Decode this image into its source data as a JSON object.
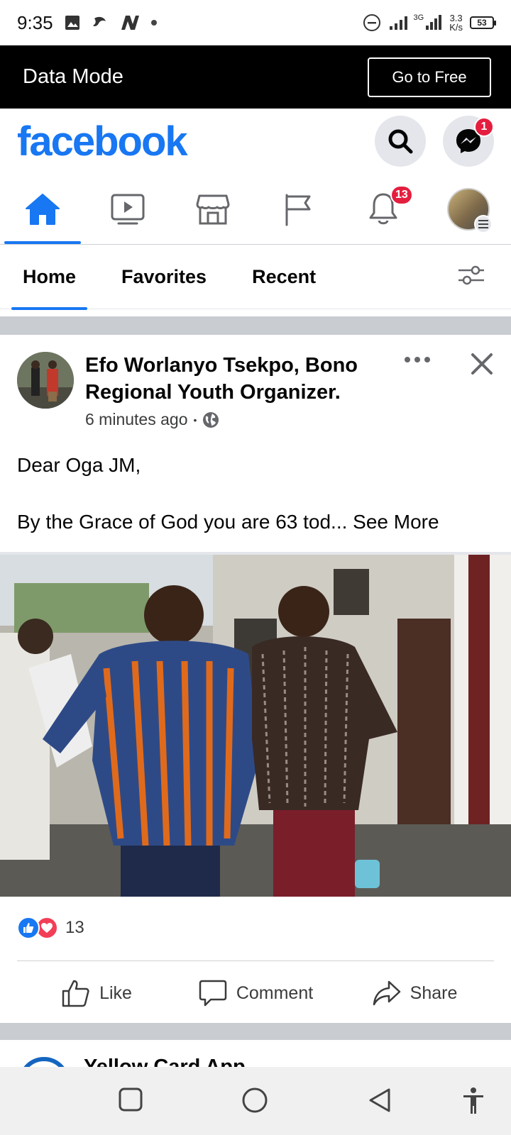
{
  "status_bar": {
    "time": "9:35",
    "net_speed_value": "3.3",
    "net_speed_unit": "K/s",
    "battery": "53",
    "signal_label": "3G"
  },
  "data_mode": {
    "label": "Data Mode",
    "button": "Go to Free"
  },
  "header": {
    "logo": "facebook",
    "messenger_badge": "1"
  },
  "nav": {
    "notifications_badge": "13",
    "active": "home"
  },
  "feed_tabs": [
    {
      "label": "Home",
      "active": true
    },
    {
      "label": "Favorites",
      "active": false
    },
    {
      "label": "Recent",
      "active": false
    }
  ],
  "post": {
    "author": "Efo Worlanyo Tsekpo, Bono Regional Youth Organizer.",
    "time": "6 minutes ago",
    "separator": "•",
    "privacy_icon": "globe-icon",
    "text_line1": "Dear Oga JM,",
    "text_line2": "By the Grace of God you are 63 tod...",
    "see_more": "See More",
    "reaction_count": "13",
    "actions": {
      "like": "Like",
      "comment": "Comment",
      "share": "Share"
    }
  },
  "next_post": {
    "author_partial": "Yellow Card App"
  },
  "colors": {
    "brand": "#1877f2",
    "badge": "#e41e3f",
    "love": "#f33e58"
  }
}
